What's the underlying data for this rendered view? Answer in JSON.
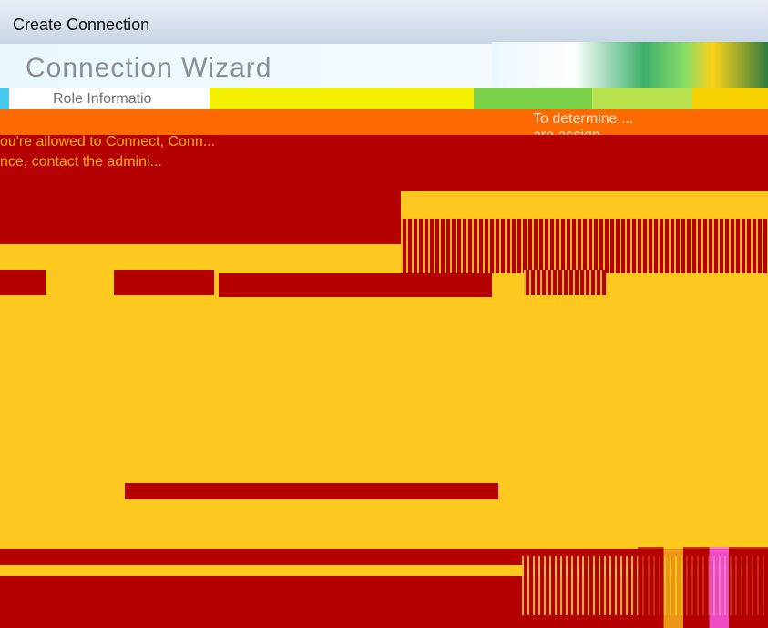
{
  "window": {
    "title": "Create Connection"
  },
  "wizard": {
    "title": "Connection Wizard",
    "step_label": "Role Informatio"
  },
  "content": {
    "left_message_line_1": "ou're allowed to Connect, Conn...",
    "left_message_line_2": "nce, contact the admini...",
    "help_text_line_1": "To determine ...",
    "help_text_line_2": "are assign..."
  },
  "colors": {
    "background": "#FFC81E",
    "accent_red": "#B40000",
    "accent_orange": "#FF6A00",
    "titlebar": "#c9d6e6"
  }
}
